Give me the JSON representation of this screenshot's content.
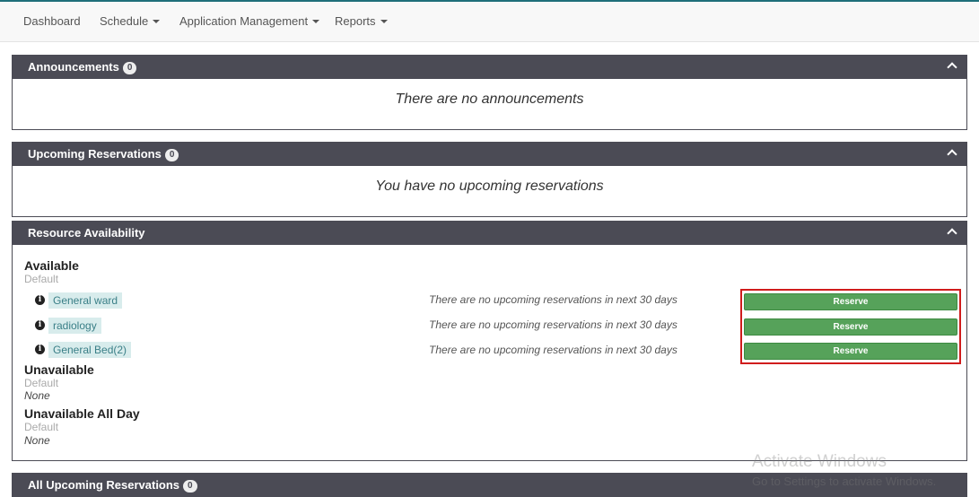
{
  "nav": {
    "dashboard": "Dashboard",
    "schedule": "Schedule",
    "application_management": "Application Management",
    "reports": "Reports"
  },
  "announcements": {
    "title": "Announcements",
    "count": "0",
    "empty_message": "There are no announcements"
  },
  "upcoming": {
    "title": "Upcoming Reservations",
    "count": "0",
    "empty_message": "You have no upcoming reservations"
  },
  "availability": {
    "title": "Resource Availability",
    "available": {
      "title": "Available",
      "group": "Default",
      "resources": [
        {
          "name": "General ward",
          "note": "There are no upcoming reservations in next 30 days",
          "action": "Reserve"
        },
        {
          "name": "radiology",
          "note": "There are no upcoming reservations in next 30 days",
          "action": "Reserve"
        },
        {
          "name": "General Bed(2)",
          "note": "There are no upcoming reservations in next 30 days",
          "action": "Reserve"
        }
      ]
    },
    "unavailable": {
      "title": "Unavailable",
      "group": "Default",
      "none": "None"
    },
    "unavailable_all_day": {
      "title": "Unavailable All Day",
      "group": "Default",
      "none": "None"
    }
  },
  "all_upcoming": {
    "title": "All Upcoming Reservations",
    "count": "0"
  },
  "watermark": {
    "line1": "Activate Windows",
    "line2": "Go to Settings to activate Windows."
  },
  "colors": {
    "panel_header": "#4b4b55",
    "reserve_green": "#56a25a",
    "highlight_red": "#d01c1c",
    "resource_tag": "#d8ecec"
  }
}
